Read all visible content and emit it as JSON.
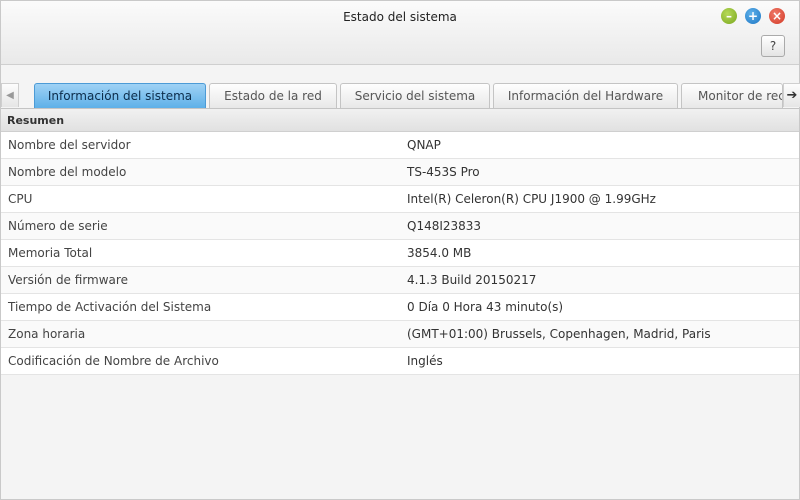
{
  "window": {
    "title": "Estado del sistema",
    "help_label": "?"
  },
  "tabs": [
    {
      "label": "Información del sistema",
      "active": true
    },
    {
      "label": "Estado de la red",
      "active": false
    },
    {
      "label": "Servicio del sistema",
      "active": false
    },
    {
      "label": "Información del Hardware",
      "active": false
    },
    {
      "label": "Monitor de recursos",
      "active": false
    }
  ],
  "summary": {
    "header": "Resumen",
    "rows": [
      {
        "label": "Nombre del servidor",
        "value": "QNAP"
      },
      {
        "label": "Nombre del modelo",
        "value": "TS-453S Pro"
      },
      {
        "label": "CPU",
        "value": "Intel(R) Celeron(R) CPU J1900 @ 1.99GHz"
      },
      {
        "label": "Número de serie",
        "value": "Q148I23833"
      },
      {
        "label": "Memoria Total",
        "value": "3854.0 MB"
      },
      {
        "label": "Versión de firmware",
        "value": "4.1.3 Build 20150217"
      },
      {
        "label": "Tiempo de Activación del Sistema",
        "value": "0 Día 0 Hora 43 minuto(s)"
      },
      {
        "label": "Zona horaria",
        "value": "(GMT+01:00) Brussels, Copenhagen, Madrid, Paris"
      },
      {
        "label": "Codificación de Nombre de Archivo",
        "value": "Inglés"
      }
    ]
  },
  "colors": {
    "active_tab": "#5eb0e8",
    "minimize": "#7aa71f",
    "maximize": "#1d76c4",
    "close": "#d23a26"
  },
  "icons": {
    "minimize": "minimize-icon",
    "maximize": "maximize-icon",
    "close": "close-icon",
    "tab_left": "arrow-left-icon",
    "tab_right": "arrow-right-icon"
  }
}
